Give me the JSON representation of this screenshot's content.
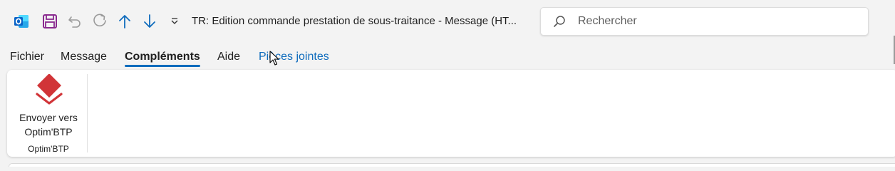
{
  "window": {
    "title": "TR: Edition commande prestation de sous-traitance  -  Message (HT...",
    "quick_access": [
      {
        "name": "outlook-app-icon"
      },
      {
        "name": "save-icon"
      },
      {
        "name": "undo-icon"
      },
      {
        "name": "redo-icon"
      },
      {
        "name": "previous-item-icon"
      },
      {
        "name": "next-item-icon"
      },
      {
        "name": "customize-toolbar-icon"
      }
    ]
  },
  "search": {
    "placeholder": "Rechercher",
    "icon": "search-icon"
  },
  "tabs": [
    {
      "label": "Fichier",
      "active": false
    },
    {
      "label": "Message",
      "active": false
    },
    {
      "label": "Compléments",
      "active": true
    },
    {
      "label": "Aide",
      "active": false
    },
    {
      "label": "Pièces jointes",
      "active": false,
      "contextual": true
    }
  ],
  "ribbon": {
    "button": {
      "label_line1": "Envoyer vers",
      "label_line2": "Optim'BTP",
      "icon": "optimbtp-logo-icon"
    },
    "group_label": "Optim'BTP"
  },
  "colors": {
    "accent": "#0f6cbd",
    "outlook_blue": "#0a64c8",
    "save_purple": "#8a2a8f",
    "optim_red": "#d13438"
  }
}
